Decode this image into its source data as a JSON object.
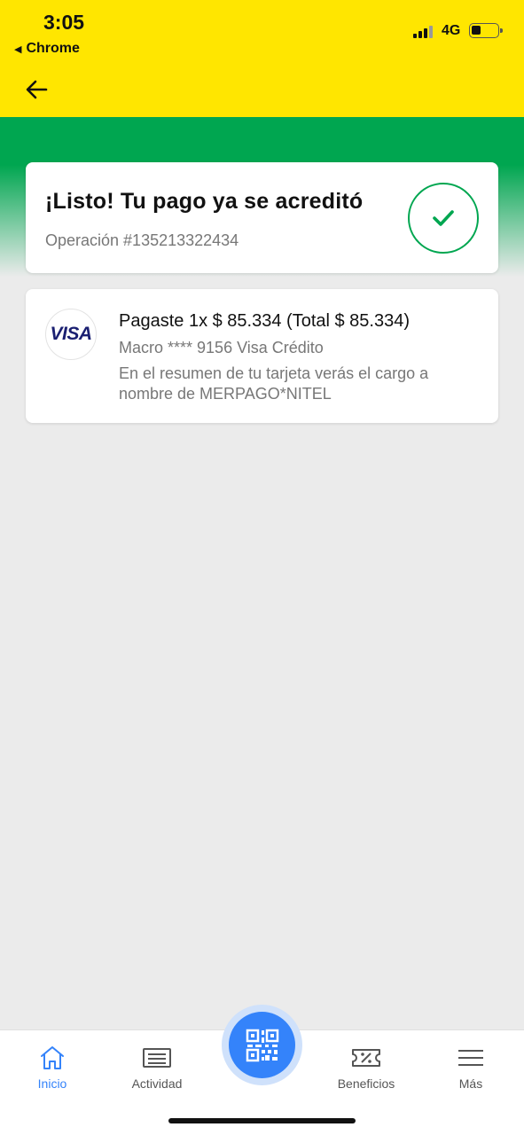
{
  "status_bar": {
    "time": "3:05",
    "back_app": "Chrome",
    "back_glyph": "◀",
    "network": "4G"
  },
  "header": {
    "back_icon": "arrow-left-icon"
  },
  "success": {
    "title": "¡Listo! Tu pago ya se acreditó",
    "operation": "Operación #135213322434",
    "icon": "check-circle-icon"
  },
  "payment": {
    "logo_text": "VISA",
    "amount_line": "Pagaste 1x $ 85.334 (Total $ 85.334)",
    "card_line": "Macro **** 9156 Visa Crédito",
    "note": "En el resumen de tu tarjeta verás el cargo a nombre de MERPAGO*NITEL"
  },
  "tabs": [
    {
      "label": "Inicio",
      "icon": "home-icon",
      "active": true
    },
    {
      "label": "Actividad",
      "icon": "activity-icon",
      "active": false
    },
    {
      "label": "Beneficios",
      "icon": "ticket-icon",
      "active": false
    },
    {
      "label": "Más",
      "icon": "menu-icon",
      "active": false
    }
  ],
  "qr_button": {
    "icon": "qr-code-icon"
  },
  "colors": {
    "brand_yellow": "#ffe600",
    "success_green": "#00a650",
    "accent_blue": "#3483fa",
    "visa_blue": "#1a1f71"
  }
}
